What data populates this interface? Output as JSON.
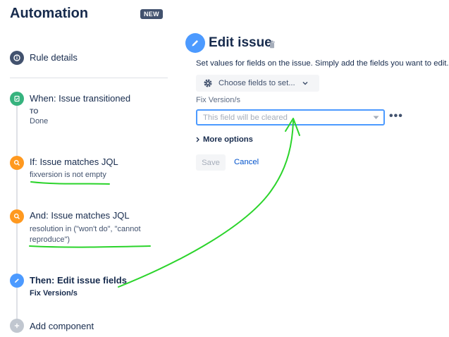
{
  "sidebar": {
    "title": "Automation",
    "badge": "NEW",
    "rule_details": "Rule details",
    "steps": {
      "trigger": {
        "title": "When: Issue transitioned",
        "to_label": "TO",
        "to_value": "Done"
      },
      "condition1": {
        "title": "If: Issue matches JQL",
        "detail": "fixversion is not empty"
      },
      "condition2": {
        "title": "And: Issue matches JQL",
        "detail_line1": "resolution in (\"won't do\", \"cannot",
        "detail_line2": "reproduce\")"
      },
      "action": {
        "title": "Then: Edit issue fields",
        "detail": "Fix Version/s"
      },
      "add": {
        "label": "Add component"
      }
    }
  },
  "editor": {
    "title": "Edit issue",
    "description": "Set values for fields on the issue. Simply add the fields you want to edit.",
    "choose_fields_label": "Choose fields to set...",
    "field_label": "Fix Version/s",
    "field_placeholder": "This field will be cleared",
    "more_menu": "•••",
    "more_options_label": "More options",
    "save_label": "Save",
    "cancel_label": "Cancel"
  },
  "icons": {
    "rule_details": "info-icon",
    "trigger": "trigger-icon",
    "condition": "search-icon",
    "action": "pencil-icon",
    "add": "plus-icon",
    "trash": "trash-icon",
    "gear": "gear-icon",
    "dropdown": "chevron-down-icon",
    "expand": "chevron-right-icon"
  },
  "colors": {
    "text": "#172B4D",
    "badge_bg": "#42526E",
    "trigger": "#36B37E",
    "condition": "#FF991F",
    "action": "#4C9AFF",
    "add": "#C1C7D0",
    "link": "#0052CC",
    "focus_border": "#4C9AFF",
    "annotation": "#2BD42B"
  }
}
